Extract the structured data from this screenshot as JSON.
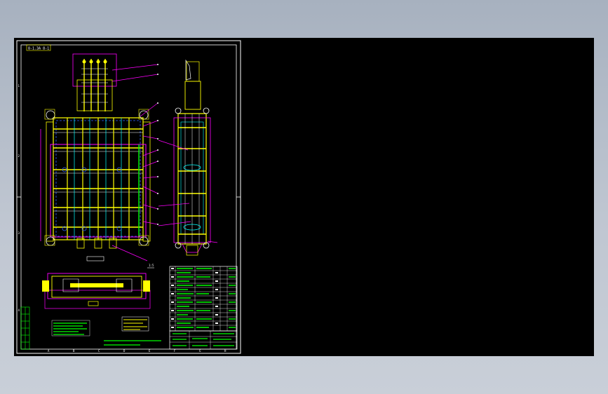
{
  "viewer": {
    "background_top": "#a7b1bf",
    "background_bottom": "#c9cfd8",
    "canvas_color": "#000000"
  },
  "drawing": {
    "sheet_label": "8-1.3A 8-1",
    "detail_marker": "1:5",
    "grid_letters": [
      "A",
      "B",
      "C",
      "D",
      "E",
      "F",
      "G",
      "H"
    ],
    "grid_numbers": [
      "1",
      "2",
      "3",
      "4"
    ],
    "colors": {
      "frame": "#ffffff",
      "outline": "#ffff00",
      "magenta": "#ff00ff",
      "cyan": "#00ffff",
      "green": "#00ff00",
      "blue": "#3060ff",
      "red": "#ff2020"
    }
  }
}
